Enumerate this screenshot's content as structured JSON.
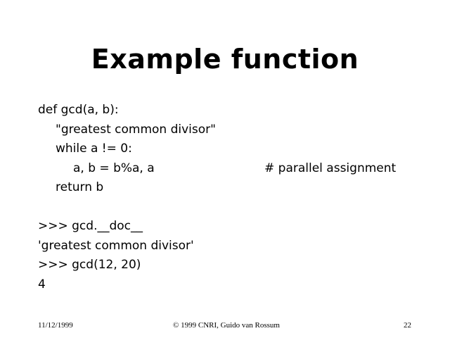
{
  "slide": {
    "title": "Example function",
    "code_lines": [
      "def gcd(a, b):",
      "\"greatest common divisor\"",
      "while a != 0:",
      "a, b = b%a, a",
      "return b"
    ],
    "comment": "# parallel assignment",
    "session_lines": [
      ">>> gcd.__doc__",
      "'greatest common divisor'",
      ">>> gcd(12, 20)",
      "4"
    ],
    "footer": {
      "date": "11/12/1999",
      "copyright": "© 1999 CNRI, Guido van Rossum",
      "page_number": "22"
    }
  }
}
